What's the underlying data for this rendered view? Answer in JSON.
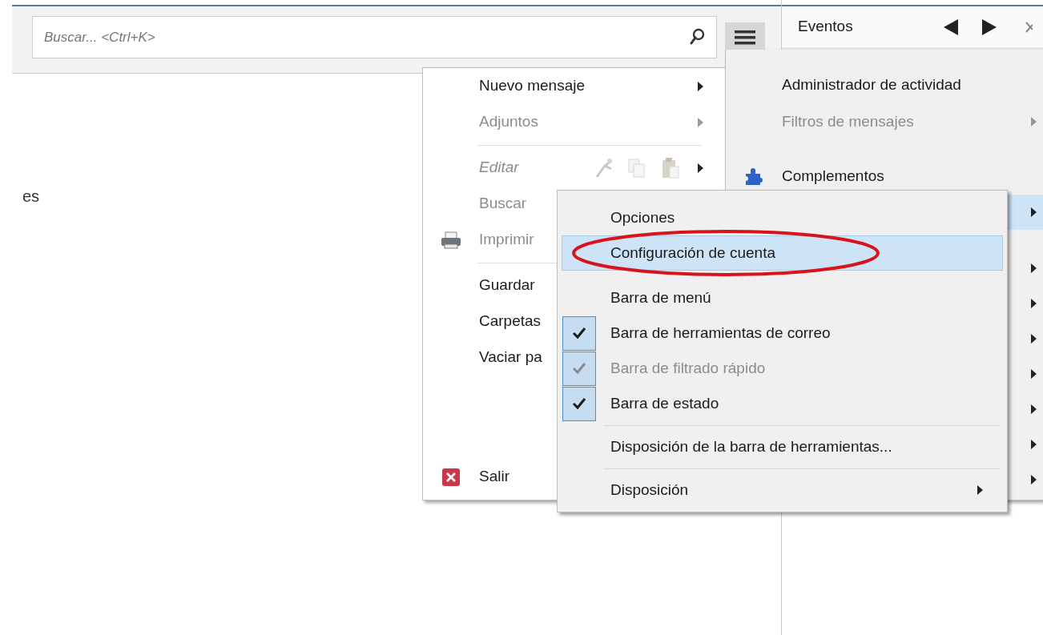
{
  "toolbar": {
    "search": {
      "placeholder": "Buscar... <Ctrl+K>"
    }
  },
  "sidebar_fragment": "es",
  "events_pane": {
    "title": "Eventos"
  },
  "main_menu": {
    "items": [
      {
        "kind": "plain",
        "label": "Nuevo mensaje",
        "disabled": false,
        "submenu": true
      },
      {
        "kind": "plain",
        "label": "Adjuntos",
        "disabled": true,
        "submenu": true
      },
      {
        "kind": "separator"
      },
      {
        "kind": "edit",
        "label": "Editar",
        "disabled": true,
        "submenu": true
      },
      {
        "kind": "plain",
        "label": "Buscar",
        "disabled": true
      },
      {
        "kind": "printer",
        "label": "Imprimir",
        "disabled": true
      },
      {
        "kind": "separator"
      },
      {
        "kind": "plain",
        "label": "Guardar",
        "disabled": false
      },
      {
        "kind": "plain",
        "label": "Carpetas",
        "disabled": false
      },
      {
        "kind": "plain",
        "label": "Vaciar pa",
        "disabled": false
      },
      {
        "kind": "exit",
        "label": "Salir",
        "disabled": false
      }
    ]
  },
  "app_menu": {
    "items": [
      {
        "kind": "plain",
        "label": "Administrador de actividad",
        "disabled": false,
        "selected": false
      },
      {
        "kind": "plain",
        "label": "Filtros de mensajes",
        "disabled": true,
        "submenu": true,
        "selected": false
      },
      {
        "kind": "addons",
        "label": "Complementos",
        "disabled": false,
        "selected": false
      },
      {
        "kind": "covered",
        "submenu": true,
        "selected": true
      },
      {
        "kind": "covered",
        "submenu": true,
        "selected": false
      },
      {
        "kind": "covered",
        "submenu": true,
        "selected": false
      },
      {
        "kind": "covered",
        "submenu": true,
        "selected": false
      },
      {
        "kind": "covered",
        "submenu": true,
        "selected": false
      },
      {
        "kind": "covered",
        "submenu": true,
        "selected": false
      },
      {
        "kind": "covered",
        "submenu": true,
        "selected": false
      },
      {
        "kind": "covered",
        "submenu": true,
        "selected": false
      }
    ]
  },
  "options_submenu": {
    "items": [
      {
        "kind": "plain",
        "label": "Opciones",
        "selected": false,
        "disabled": false
      },
      {
        "kind": "plain",
        "label": "Configuración de cuenta",
        "selected": true,
        "disabled": false,
        "circled": true
      },
      {
        "kind": "check",
        "label": "Barra de menú",
        "checked": false,
        "selected": false,
        "disabled": false
      },
      {
        "kind": "check",
        "label": "Barra de herramientas de correo",
        "checked": true,
        "selected": false,
        "disabled": false
      },
      {
        "kind": "check",
        "label": "Barra de filtrado rápido",
        "checked": true,
        "selected": false,
        "disabled": true
      },
      {
        "kind": "check",
        "label": "Barra de estado",
        "checked": true,
        "selected": false,
        "disabled": false
      },
      {
        "kind": "separator"
      },
      {
        "kind": "plain",
        "label": "Disposición de la barra de herramientas...",
        "selected": false,
        "disabled": false
      },
      {
        "kind": "separator"
      },
      {
        "kind": "plain",
        "label": "Disposición",
        "selected": false,
        "disabled": false,
        "submenu": true
      }
    ]
  }
}
